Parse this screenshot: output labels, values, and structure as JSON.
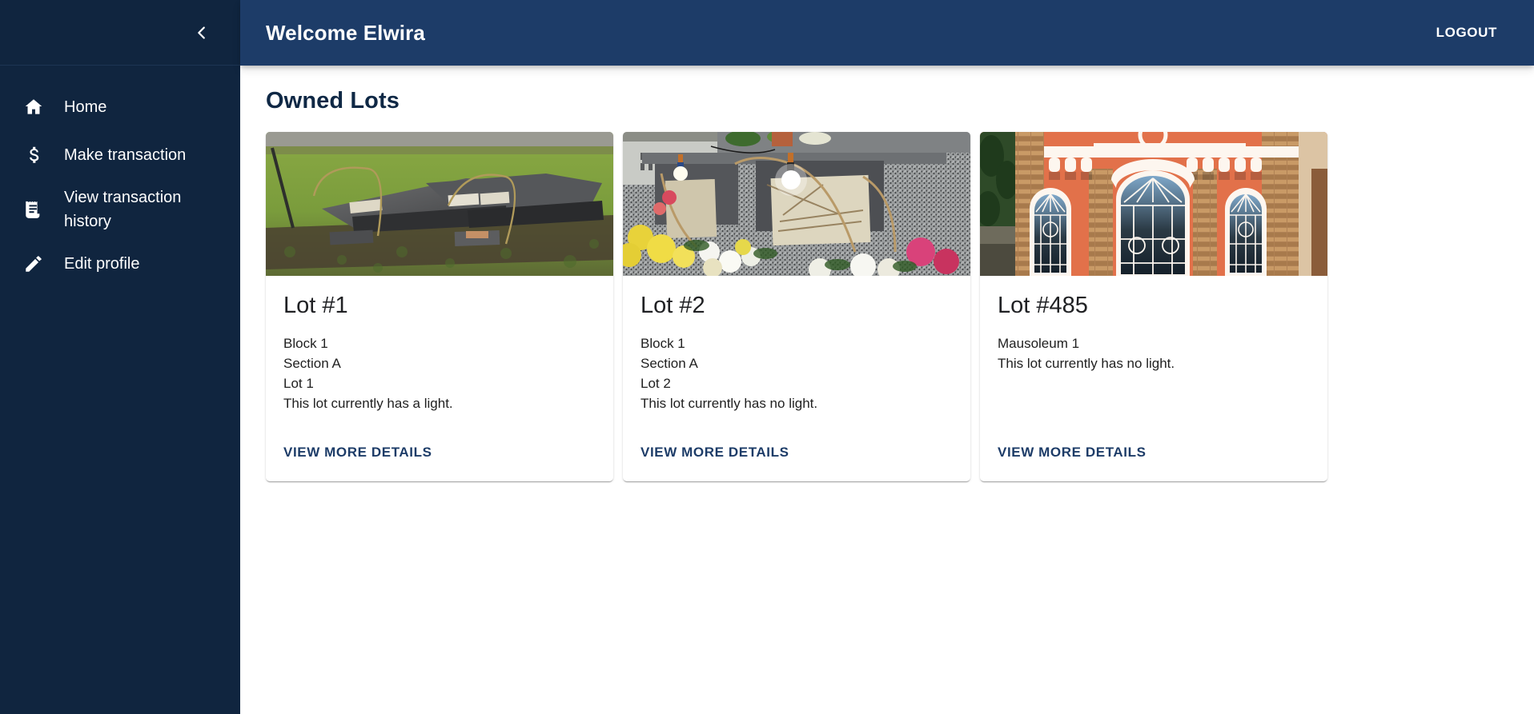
{
  "sidebar": {
    "collapse_icon": "chevron-left-icon",
    "items": [
      {
        "label": "Home",
        "icon": "home-icon"
      },
      {
        "label": "Make transaction",
        "icon": "dollar-icon"
      },
      {
        "label": "View transaction history",
        "icon": "receipt-icon"
      },
      {
        "label": "Edit profile",
        "icon": "pencil-icon"
      }
    ]
  },
  "topbar": {
    "title": "Welcome Elwira",
    "logout_label": "LOGOUT"
  },
  "page": {
    "title": "Owned Lots"
  },
  "colors": {
    "sidebar_bg": "#10253f",
    "topbar_bg": "#1d3c68",
    "accent": "#1d3c68",
    "page_title": "#0f2845",
    "content_bg": "#ffffff"
  },
  "cards": [
    {
      "title": "Lot #1",
      "lines": [
        "Block 1",
        "Section A",
        "Lot 1",
        "This lot currently has a light."
      ],
      "action_label": "VIEW MORE DETAILS",
      "image_alt": "grave-slabs-on-grass-photo"
    },
    {
      "title": "Lot #2",
      "lines": [
        "Block 1",
        "Section A",
        "Lot 2",
        "This lot currently has no light."
      ],
      "action_label": "VIEW MORE DETAILS",
      "image_alt": "granite-niche-with-lights-and-flowers-photo"
    },
    {
      "title": "Lot #485",
      "lines": [
        "Mausoleum 1",
        "This lot currently has no light."
      ],
      "action_label": "VIEW MORE DETAILS",
      "image_alt": "orange-mausoleum-facade-photo"
    }
  ]
}
